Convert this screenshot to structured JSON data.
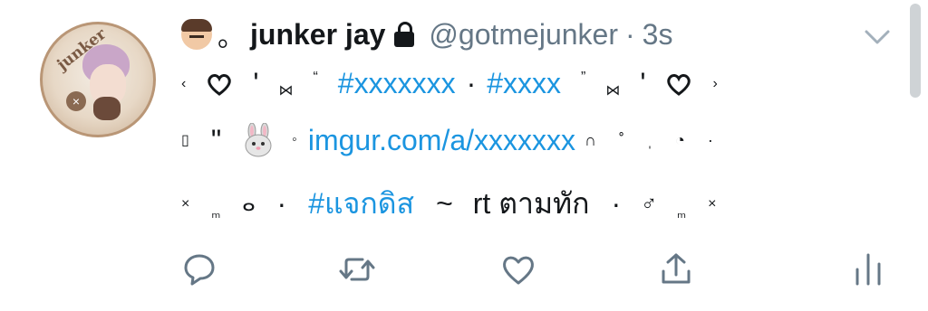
{
  "tweet": {
    "display_name": "junker jay",
    "name_prefix": "。",
    "handle": "@gotmejunker",
    "separator": "·",
    "time": "3s",
    "avatar_text": "junker",
    "line1": {
      "open": "‹",
      "q1": "'",
      "bow1": "⋈",
      "q2": "“",
      "tag1": "#xxxxxxx",
      "mid": "·",
      "tag2": "#xxxx",
      "q3": "”",
      "bow2": "⋈",
      "q4": "'",
      "close": "›"
    },
    "line2": {
      "lead": "▯",
      "quote": "\"",
      "ring": "◦",
      "link": "imgur.com/a/xxxxxxx",
      "trail": "∩ ˚ ˌ ◔ ·"
    },
    "line3": {
      "x1": "×",
      "m1": "ₘ",
      "d1": "ⴰ",
      "dot1": "·",
      "tag": "#แจกดิส",
      "tilde": "~",
      "text": "rt ตามทัก",
      "dot2": "·",
      "male": "♂",
      "m2": "ₘ",
      "x2": "×"
    }
  },
  "icons": {
    "avatar": "avatar",
    "face": "man-face-emoji",
    "lock": "lock-icon",
    "chevron": "chevron-down-icon",
    "reply": "reply-icon",
    "retweet": "retweet-icon",
    "like": "heart-icon",
    "share": "share-icon",
    "analytics": "analytics-icon"
  },
  "colors": {
    "link": "#1b95e0",
    "text": "#14171a",
    "muted": "#657786",
    "icon": "#657786"
  }
}
